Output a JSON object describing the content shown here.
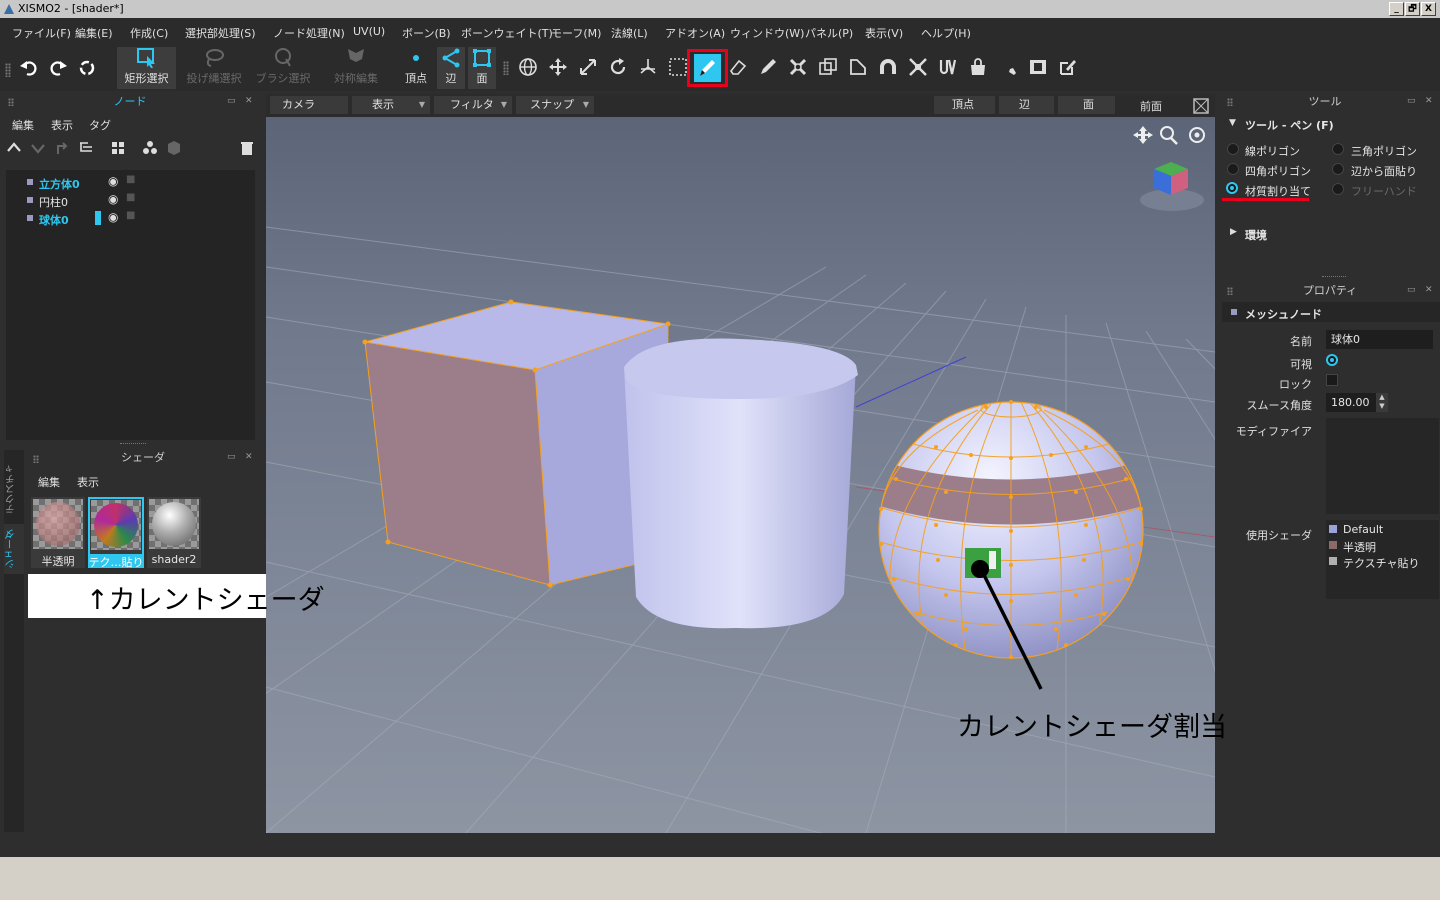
{
  "window": {
    "title": "XISMO2 - [shader*]",
    "minimize": "_",
    "restore": "🗗",
    "close": "X"
  },
  "menu": [
    "ファイル(F)",
    "編集(E)",
    "作成(C)",
    "選択部処理(S)",
    "ノード処理(N)",
    "UV(U)",
    "ボーン(B)",
    "ボーンウェイト(T)",
    "モーフ(M)",
    "法線(L)",
    "アドオン(A)",
    "ウィンドウ(W)",
    "パネル(P)",
    "表示(V)",
    "ヘルプ(H)"
  ],
  "toolbar": {
    "rect_select": "矩形選択",
    "lasso_select": "投げ縄選択",
    "brush_select": "ブラシ選択",
    "symmetric_edit": "対称編集",
    "vertex": "頂点",
    "edge": "辺",
    "face": "面"
  },
  "node_panel": {
    "title": "ノード",
    "menu": [
      "編集",
      "表示",
      "タグ"
    ],
    "items": [
      {
        "name": "立方体0",
        "highlight": true
      },
      {
        "name": "円柱0",
        "highlight": false
      },
      {
        "name": "球体0",
        "highlight": true
      }
    ]
  },
  "shader_panel": {
    "title": "シェーダ",
    "menu": [
      "編集",
      "表示"
    ],
    "side_tabs": [
      "テクスチャ",
      "シェーダ"
    ],
    "items": [
      {
        "label": "半透明",
        "selected": false
      },
      {
        "label": "テク…貼り",
        "selected": true
      },
      {
        "label": "shader2",
        "selected": false
      }
    ]
  },
  "viewport_bar": {
    "left": [
      "カメラ",
      "表示",
      "フィルタ",
      "スナップ"
    ],
    "right": [
      "頂点",
      "辺",
      "面"
    ],
    "view_name": "前面"
  },
  "tool_panel": {
    "title": "ツール",
    "tool_header": "ツール - ペン (F)",
    "options": [
      {
        "label": "線ポリゴン",
        "checked": false,
        "enabled": true
      },
      {
        "label": "三角ポリゴン",
        "checked": false,
        "enabled": true
      },
      {
        "label": "四角ポリゴン",
        "checked": false,
        "enabled": true
      },
      {
        "label": "辺から面貼り",
        "checked": false,
        "enabled": true
      },
      {
        "label": "材質割り当て",
        "checked": true,
        "enabled": true
      },
      {
        "label": "フリーハンド",
        "checked": false,
        "enabled": false
      }
    ],
    "environment": "環境"
  },
  "properties": {
    "title": "プロパティ",
    "section": "メッシュノード",
    "name_label": "名前",
    "name_value": "球体0",
    "visible_label": "可視",
    "lock_label": "ロック",
    "smooth_label": "スムース角度",
    "smooth_value": "180.00",
    "modifier_label": "モディファイア",
    "shader_label": "使用シェーダ",
    "shaders": [
      {
        "name": "Default",
        "color": "#9aa3d6"
      },
      {
        "name": "半透明",
        "color": "#8c6a6a"
      },
      {
        "name": "テクスチャ貼り",
        "color": "#b0b0b0"
      }
    ]
  },
  "annotations": {
    "current_shader": "↑カレントシェーダ",
    "assign": "カレントシェーダ割当"
  },
  "colors": {
    "accent": "#2fc7ef",
    "highlight_red": "#e8001c",
    "mesh_orange": "#f4a020"
  }
}
